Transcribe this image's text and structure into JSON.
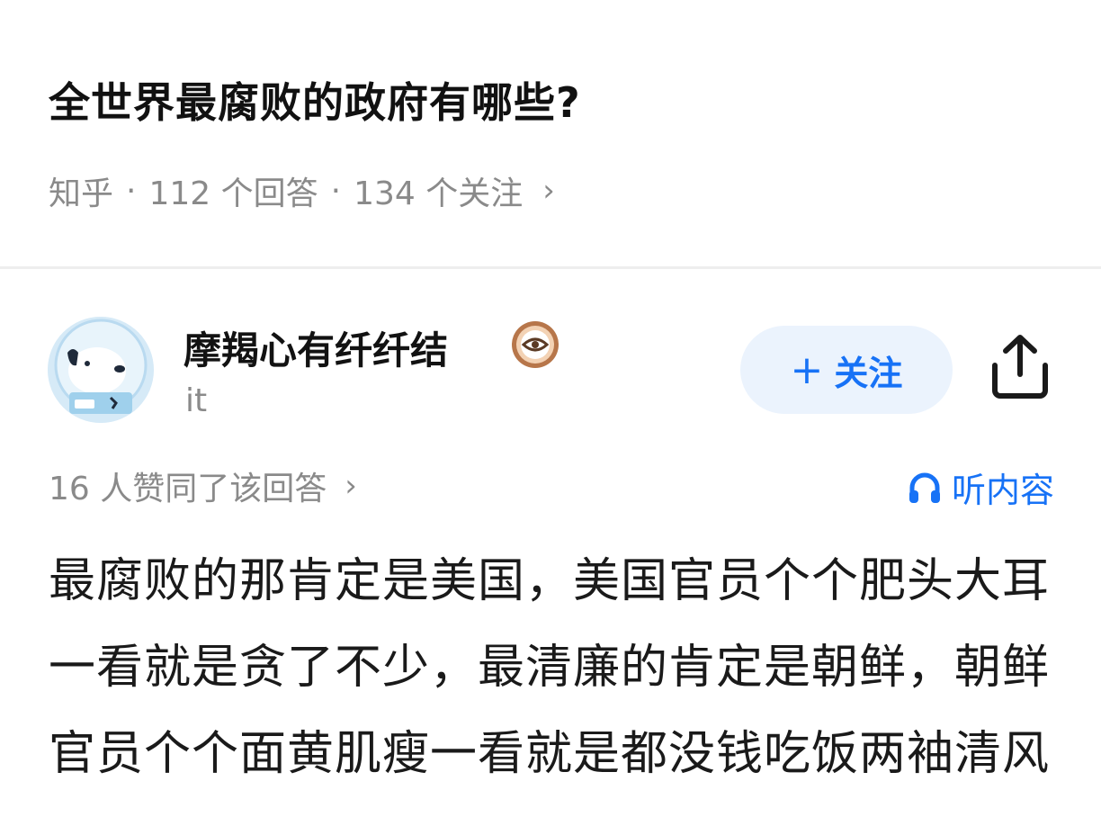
{
  "question": {
    "title": "全世界最腐败的政府有哪些?",
    "source": "知乎",
    "answers_count": "112 个回答",
    "followers_count": "134 个关注",
    "separator": "·",
    "chevron": "›"
  },
  "author": {
    "name": "摩羯心有纤纤结",
    "subtitle": "it",
    "follow_label": "关注",
    "follow_plus": "+"
  },
  "answer_meta": {
    "votes_text": "16 人赞同了该回答",
    "chevron": "›",
    "listen_label": "听内容"
  },
  "answer": {
    "text": "最腐败的那肯定是美国，美国官员个个肥头大耳一看就是贪了不少，最清廉的肯定是朝鲜，朝鲜官员个个面黄肌瘦一看就是都没钱吃饭两袖清风"
  },
  "colors": {
    "accent": "#1772f6",
    "follow_bg": "#ebf3fd",
    "meta_gray": "#8a8a8a",
    "badge": "#c8875a"
  },
  "icons": {
    "badge": "eye-badge-icon",
    "share": "share-icon",
    "listen": "headphones-icon"
  }
}
